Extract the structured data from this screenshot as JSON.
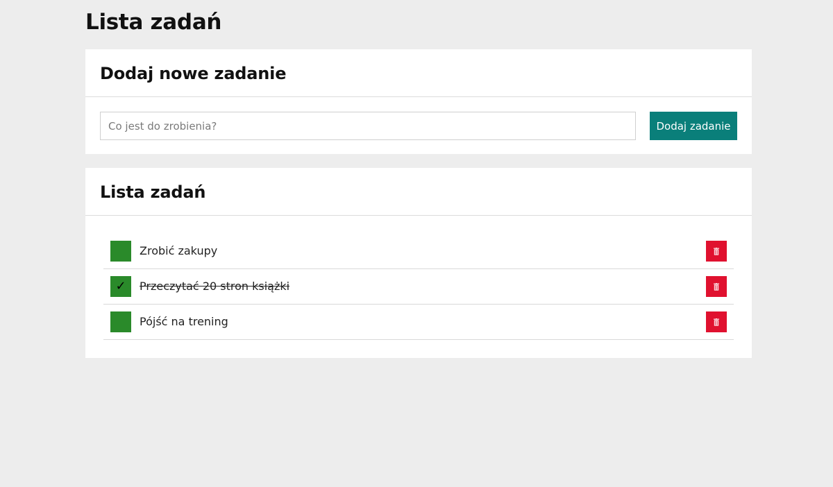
{
  "page": {
    "title": "Lista zadań"
  },
  "add_section": {
    "title": "Dodaj nowe zadanie",
    "input_placeholder": "Co jest do zrobienia?",
    "input_value": "",
    "button_label": "Dodaj zadanie"
  },
  "list_section": {
    "title": "Lista zadań",
    "tasks": [
      {
        "text": "Zrobić zakupy",
        "done": false,
        "check_mark": ""
      },
      {
        "text": "Przeczytać 20 stron książki",
        "done": true,
        "check_mark": "✓"
      },
      {
        "text": "Pójść na trening",
        "done": false,
        "check_mark": ""
      }
    ]
  },
  "icons": {
    "delete": "trash-icon",
    "check": "checkmark-icon"
  },
  "colors": {
    "background": "#ededed",
    "accent": "#0a7f7a",
    "checkbox": "#2a8a2a",
    "delete": "#e0112f"
  }
}
